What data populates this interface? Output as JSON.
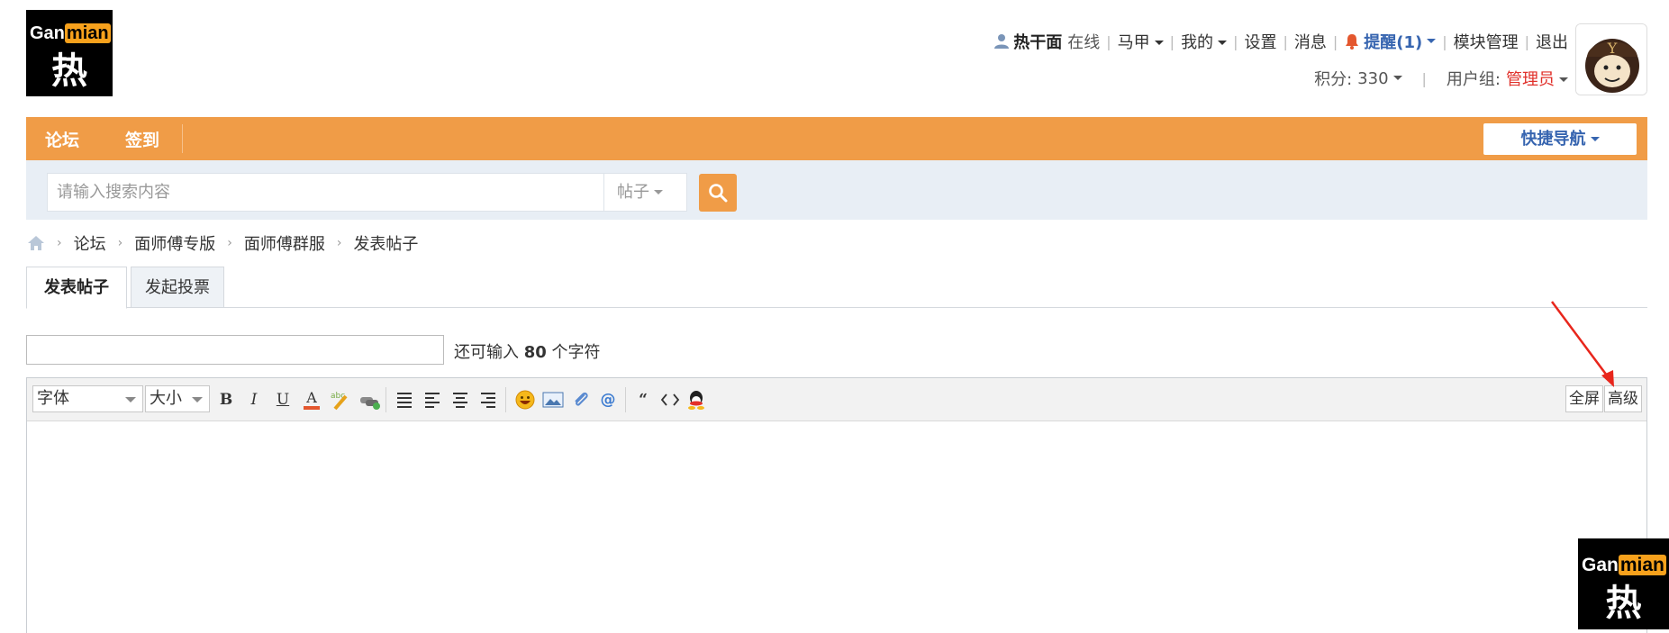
{
  "logo": {
    "text_left": "Gan",
    "text_right": "mian",
    "char": "热"
  },
  "topbar": {
    "username": "热干面",
    "status": "在线",
    "links": [
      "马甲",
      "我的",
      "设置",
      "消息"
    ],
    "remind": "提醒(1)",
    "manage": "模块管理",
    "logout": "退出"
  },
  "row2": {
    "points_label": "积分:",
    "points_value": "330",
    "group_label": "用户组:",
    "group_value": "管理员"
  },
  "nav": {
    "items": [
      "论坛",
      "签到"
    ],
    "quicknav": "快捷导航"
  },
  "search": {
    "placeholder": "请输入搜索内容",
    "type": "帖子"
  },
  "breadcrumb": [
    "论坛",
    "面师傅专版",
    "面师傅群服",
    "发表帖子"
  ],
  "tabs": [
    "发表帖子",
    "发起投票"
  ],
  "subject": {
    "remaining_pre": "还可输入",
    "remaining_count": "80",
    "remaining_post": "个字符"
  },
  "editor": {
    "font_select": "字体",
    "size_select": "大小",
    "fullscreen": "全屏",
    "advanced": "高级"
  },
  "colors": {
    "accent": "#f09c47",
    "link": "#3765b0",
    "group": "#e0302a",
    "band": "#e8eef5"
  },
  "icons": [
    "user-icon",
    "bell-icon",
    "home-icon",
    "search-icon",
    "bold-icon",
    "italic-icon",
    "underline-icon",
    "font-color-icon",
    "highlight-icon",
    "link-icon",
    "justify-icon",
    "align-left-icon",
    "align-center-icon",
    "align-right-icon",
    "emoji-icon",
    "image-icon",
    "attachment-icon",
    "mention-icon",
    "quote-icon",
    "code-icon",
    "qq-icon"
  ]
}
